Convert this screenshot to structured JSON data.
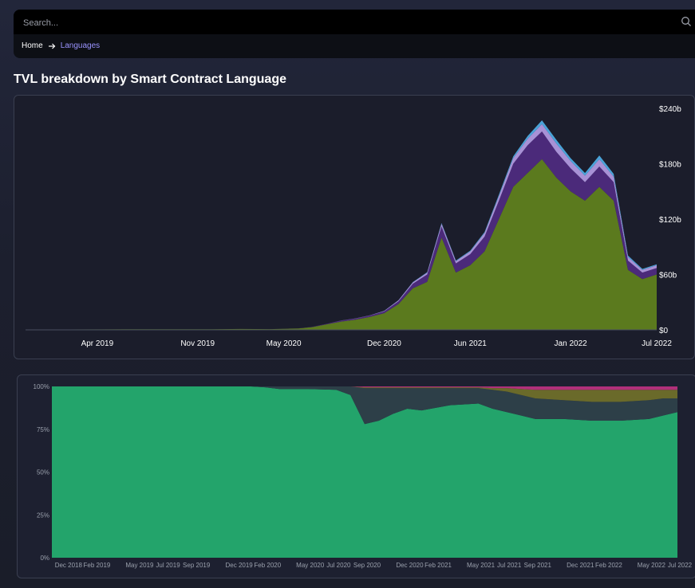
{
  "search": {
    "placeholder": "Search..."
  },
  "breadcrumb": {
    "home": "Home",
    "current": "Languages"
  },
  "page": {
    "title": "TVL breakdown by Smart Contract Language"
  },
  "colors": {
    "area_main": "#5b7a1e",
    "area_purple": "#4b2a7a",
    "area_lilac": "#a891d6",
    "area_blue": "#4aa3d8",
    "green100": "#23a46b",
    "slate": "#2d3f48"
  },
  "chart_data": [
    {
      "type": "area",
      "title": "",
      "xlabel": "",
      "ylabel": "",
      "ylim": [
        0,
        240
      ],
      "y_axis_position": "right",
      "y_tick_labels": [
        "$0",
        "$60b",
        "$120b",
        "$180b",
        "$240b"
      ],
      "x_tick_labels": [
        "Apr 2019",
        "Nov 2019",
        "May 2020",
        "Dec 2020",
        "Jun 2021",
        "Jan 2022",
        "Jul 2022"
      ],
      "x": [
        "2018-12",
        "2019-02",
        "2019-04",
        "2019-06",
        "2019-08",
        "2019-10",
        "2019-12",
        "2020-02",
        "2020-04",
        "2020-06",
        "2020-07",
        "2020-08",
        "2020-09",
        "2020-10",
        "2020-11",
        "2020-12",
        "2021-01",
        "2021-02",
        "2021-03",
        "2021-04",
        "2021-05",
        "2021-06",
        "2021-07",
        "2021-08",
        "2021-09",
        "2021-10",
        "2021-11",
        "2021-12",
        "2022-01",
        "2022-02",
        "2022-03",
        "2022-04",
        "2022-05",
        "2022-06",
        "2022-07"
      ],
      "series": [
        {
          "values": [
            0.3,
            0.4,
            0.5,
            0.6,
            0.7,
            0.6,
            0.6,
            1,
            0.8,
            1.5,
            3,
            6,
            9,
            11,
            14,
            18,
            28,
            45,
            52,
            100,
            62,
            70,
            85,
            120,
            155,
            170,
            185,
            165,
            150,
            140,
            155,
            140,
            65,
            55,
            60
          ]
        },
        {
          "values": [
            0,
            0,
            0,
            0,
            0,
            0,
            0,
            0,
            0,
            0.1,
            0.3,
            0.6,
            1,
            1.2,
            1.5,
            2,
            3,
            5,
            8,
            12,
            10,
            12,
            16,
            20,
            25,
            30,
            30,
            28,
            25,
            20,
            22,
            20,
            10,
            7,
            7
          ]
        },
        {
          "values": [
            0,
            0,
            0,
            0,
            0,
            0,
            0,
            0,
            0,
            0,
            0,
            0,
            0.1,
            0.2,
            0.3,
            0.5,
            1,
            1.5,
            2,
            3,
            2.5,
            3,
            4,
            5,
            6,
            7,
            8,
            9,
            8,
            7,
            8,
            6,
            4,
            3,
            3
          ]
        },
        {
          "values": [
            0,
            0,
            0,
            0,
            0,
            0,
            0,
            0,
            0,
            0,
            0,
            0,
            0,
            0,
            0,
            0.1,
            0.2,
            0.3,
            0.5,
            0.8,
            0.6,
            0.8,
            1,
            1.5,
            2,
            3,
            4,
            4,
            3,
            3,
            4,
            3,
            1.5,
            1,
            1
          ]
        }
      ]
    },
    {
      "type": "area",
      "title": "",
      "xlabel": "",
      "ylabel": "",
      "ylim": [
        0,
        100
      ],
      "y_tick_labels": [
        "0%",
        "25%",
        "50%",
        "75%",
        "100%"
      ],
      "x_tick_labels": [
        "Dec 2018",
        "Feb 2019",
        "May 2019",
        "Jul 2019",
        "Sep 2019",
        "Dec 2019",
        "Feb 2020",
        "May 2020",
        "Jul 2020",
        "Sep 2020",
        "Dec 2020",
        "Feb 2021",
        "May 2021",
        "Jul 2021",
        "Sep 2021",
        "Dec 2021",
        "Feb 2022",
        "May 2022",
        "Jul 2022"
      ],
      "x": [
        "2018-11",
        "2019-01",
        "2019-03",
        "2019-05",
        "2019-07",
        "2019-09",
        "2019-11",
        "2020-01",
        "2020-02",
        "2020-03",
        "2020-05",
        "2020-07",
        "2020-08",
        "2020-09",
        "2020-10",
        "2020-11",
        "2020-12",
        "2021-01",
        "2021-03",
        "2021-05",
        "2021-06",
        "2021-07",
        "2021-08",
        "2021-09",
        "2021-11",
        "2022-01",
        "2022-03",
        "2022-05",
        "2022-06",
        "2022-07"
      ],
      "series": [
        {
          "values": [
            100,
            100,
            100,
            100,
            100,
            100,
            100,
            100,
            99.5,
            98.5,
            98.5,
            98,
            95,
            78,
            80,
            84,
            87,
            86,
            89,
            90,
            87,
            85,
            83,
            81,
            81,
            80,
            80,
            81,
            83,
            85
          ]
        },
        {
          "values": [
            0,
            0,
            0,
            0,
            0,
            0,
            0,
            0,
            0.5,
            1.5,
            1.5,
            2,
            5,
            21,
            19,
            15,
            12,
            13,
            10,
            9,
            11,
            12,
            12,
            12,
            11,
            11,
            11,
            11,
            10,
            8
          ]
        },
        {
          "values": [
            0,
            0,
            0,
            0,
            0,
            0,
            0,
            0,
            0,
            0,
            0,
            0,
            0,
            0.5,
            0.5,
            0.5,
            0.5,
            0.5,
            0.5,
            0.5,
            1,
            2,
            3.5,
            5,
            6,
            7,
            7,
            6,
            5,
            5
          ]
        },
        {
          "values": [
            0,
            0,
            0,
            0,
            0,
            0,
            0,
            0,
            0,
            0,
            0,
            0,
            0,
            0.5,
            0.5,
            0.5,
            0.5,
            0.5,
            0.5,
            0.5,
            1,
            1,
            1.5,
            2,
            2,
            2,
            2,
            2,
            2,
            2
          ]
        }
      ]
    }
  ]
}
